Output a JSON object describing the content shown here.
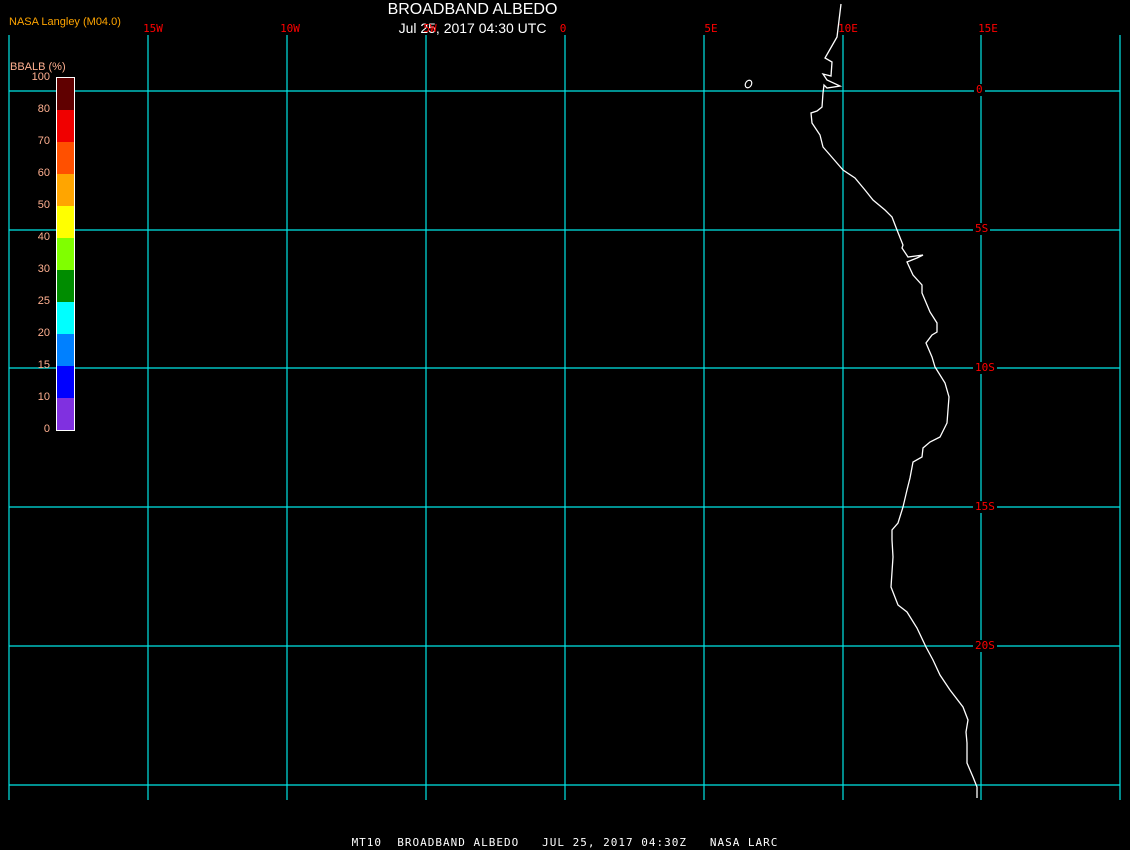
{
  "header": {
    "title": "BROADBAND ALBEDO",
    "subtitle": "Jul 25, 2017 04:30 UTC",
    "credit": "NASA Langley (M04.0)"
  },
  "map": {
    "longitude_labels": [
      "15W",
      "10W",
      "5W",
      "0",
      "5E",
      "10E",
      "15E"
    ],
    "latitude_labels": [
      "0",
      "5S",
      "10S",
      "15S",
      "20S"
    ],
    "grid_color": "#00e5e5",
    "coastline_color": "#ffffff",
    "label_color": "#ff0000"
  },
  "legend": {
    "title": "BBALB (%)",
    "labels": [
      "100",
      "80",
      "70",
      "60",
      "50",
      "40",
      "30",
      "25",
      "20",
      "15",
      "10",
      "0"
    ],
    "colors": [
      "#600000",
      "#f00000",
      "#ff5000",
      "#ffa500",
      "#ffff00",
      "#80ff00",
      "#008c00",
      "#00ffff",
      "#0080ff",
      "#0000ff",
      "#8030e0"
    ]
  },
  "footer": {
    "text": "MT10  BROADBAND ALBEDO   JUL 25, 2017 04:30Z   NASA LARC"
  }
}
